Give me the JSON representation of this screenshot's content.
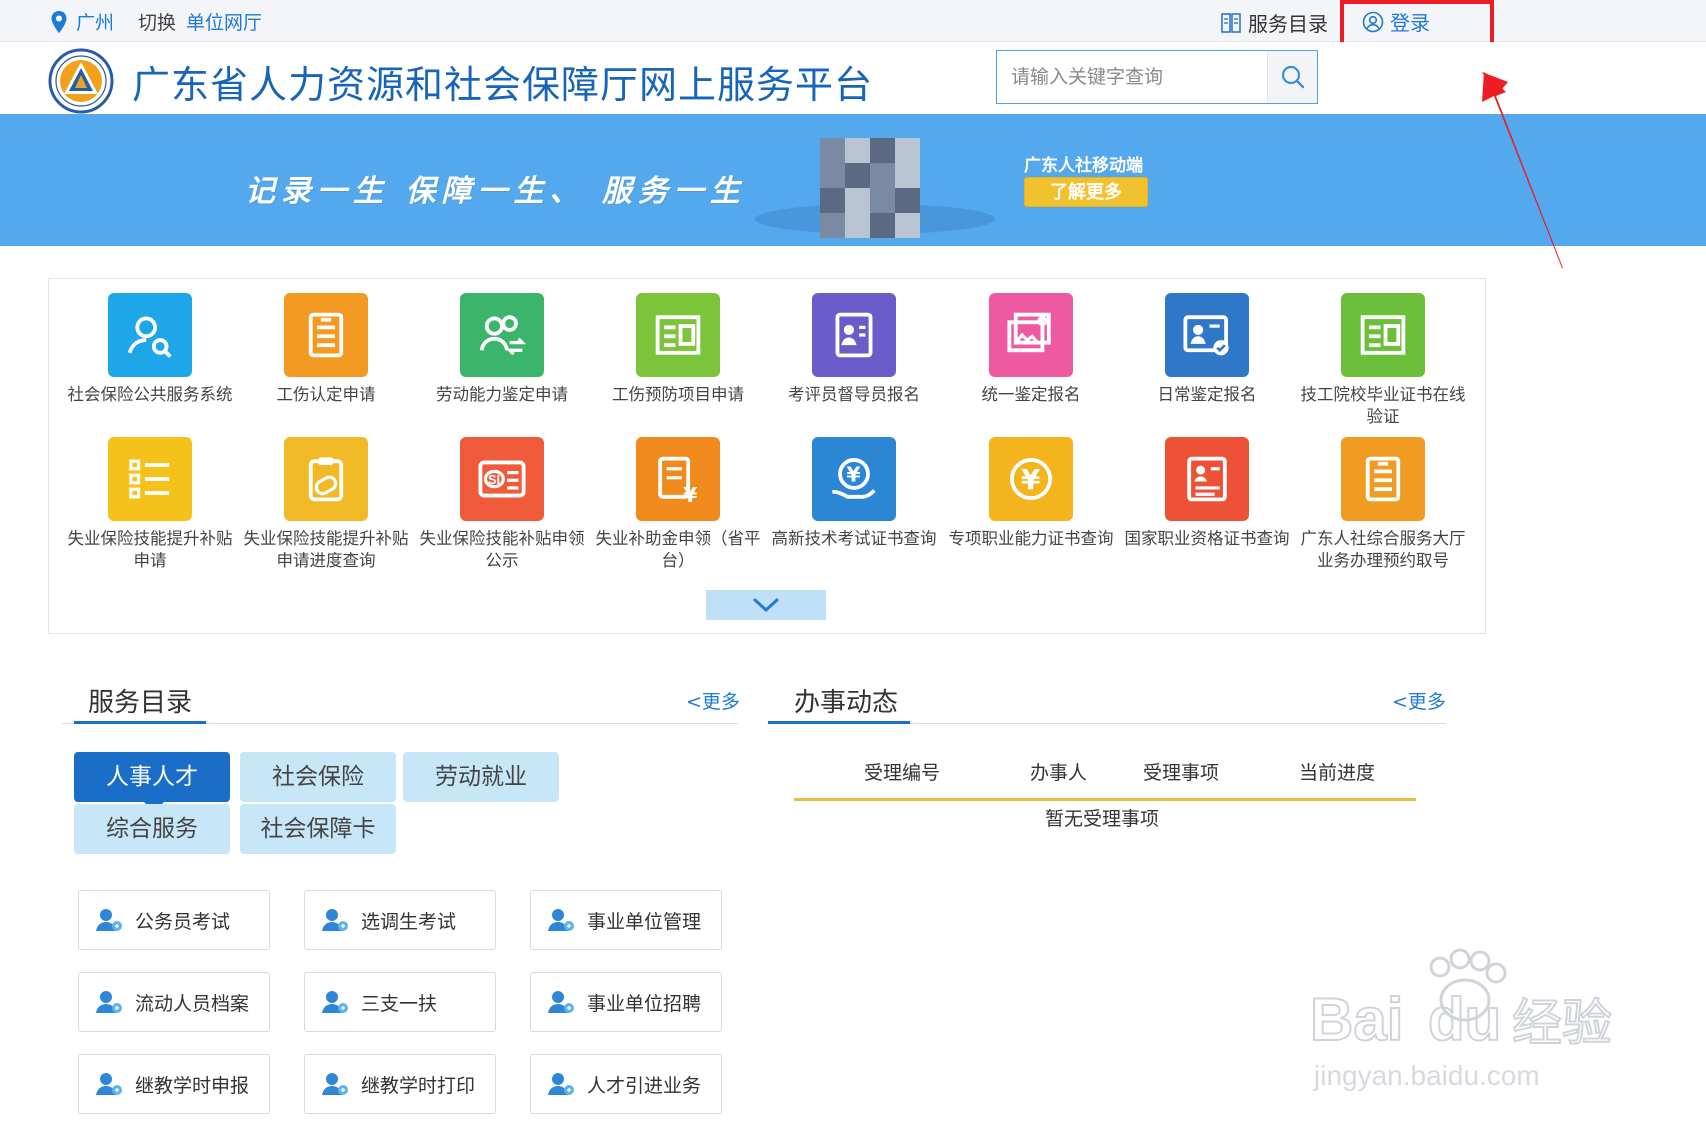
{
  "topbar": {
    "city": "广州",
    "switch_label": "切换",
    "unit_hall": "单位网厅",
    "service_directory": "服务目录",
    "login": "登录"
  },
  "header": {
    "title": "广东省人力资源和社会保障厅网上服务平台",
    "search_placeholder": "请输入关键字查询"
  },
  "banner": {
    "slogan": "记录一生  保障一生、 服务一生",
    "mobile_title": "广东人社移动端",
    "learn_more": "了解更多"
  },
  "services": [
    {
      "label": "社会保险公共服务系统",
      "color": "#1ea7e8",
      "icon": "person-search-icon"
    },
    {
      "label": "工伤认定申请",
      "color": "#f39a22",
      "icon": "document-icon"
    },
    {
      "label": "劳动能力鉴定申请",
      "color": "#3bb56b",
      "icon": "people-exchange-icon"
    },
    {
      "label": "工伤预防项目申请",
      "color": "#7cc43a",
      "icon": "form-icon"
    },
    {
      "label": "考评员督导员报名",
      "color": "#6a5cc9",
      "icon": "id-card-icon"
    },
    {
      "label": "统一鉴定报名",
      "color": "#ee5aa2",
      "icon": "certificate-icon"
    },
    {
      "label": "日常鉴定报名",
      "color": "#2f78c8",
      "icon": "person-card-icon"
    },
    {
      "label": "技工院校毕业证书在线验证",
      "color": "#6cbf3a",
      "icon": "form-icon"
    },
    {
      "label": "失业保险技能提升补贴申请",
      "color": "#f4c21b",
      "icon": "list-icon"
    },
    {
      "label": "失业保险技能提升补贴申请进度查询",
      "color": "#f2b927",
      "icon": "clipboard-icon"
    },
    {
      "label": "失业保险技能补贴申领公示",
      "color": "#ef5b3a",
      "icon": "si-card-icon"
    },
    {
      "label": "失业补助金申领（省平台）",
      "color": "#f08a1c",
      "icon": "yuan-document-icon"
    },
    {
      "label": "高新技术考试证书查询",
      "color": "#2b86d4",
      "icon": "yuan-hand-icon"
    },
    {
      "label": "专项职业能力证书查询",
      "color": "#f4b41d",
      "icon": "yuan-circle-icon"
    },
    {
      "label": "国家职业资格证书查询",
      "color": "#ee5236",
      "icon": "resume-icon"
    },
    {
      "label": "广东人社综合服务大厅业务办理预约取号",
      "color": "#f09b22",
      "icon": "document-icon"
    }
  ],
  "service_dir": {
    "title": "服务目录",
    "more": "<更多",
    "tabs": [
      {
        "label": "人事人才",
        "active": true
      },
      {
        "label": "社会保险",
        "active": false
      },
      {
        "label": "劳动就业",
        "active": false
      },
      {
        "label": "综合服务",
        "active": false
      },
      {
        "label": "社会保障卡",
        "active": false
      }
    ],
    "items": [
      "公务员考试",
      "选调生考试",
      "事业单位管理",
      "流动人员档案",
      "三支一扶",
      "事业单位招聘",
      "继教学时申报",
      "继教学时打印",
      "人才引进业务"
    ]
  },
  "dynamics": {
    "title": "办事动态",
    "more": "<更多",
    "columns": [
      "受理编号",
      "办事人",
      "受理事项",
      "当前进度"
    ],
    "empty": "暂无受理事项"
  },
  "colors": {
    "brand_blue": "#1765b8",
    "banner_blue": "#53a8ee",
    "highlight_red": "#ee1c25",
    "tab_active": "#1b6ec8",
    "tab_inactive": "#c7e6f8"
  }
}
